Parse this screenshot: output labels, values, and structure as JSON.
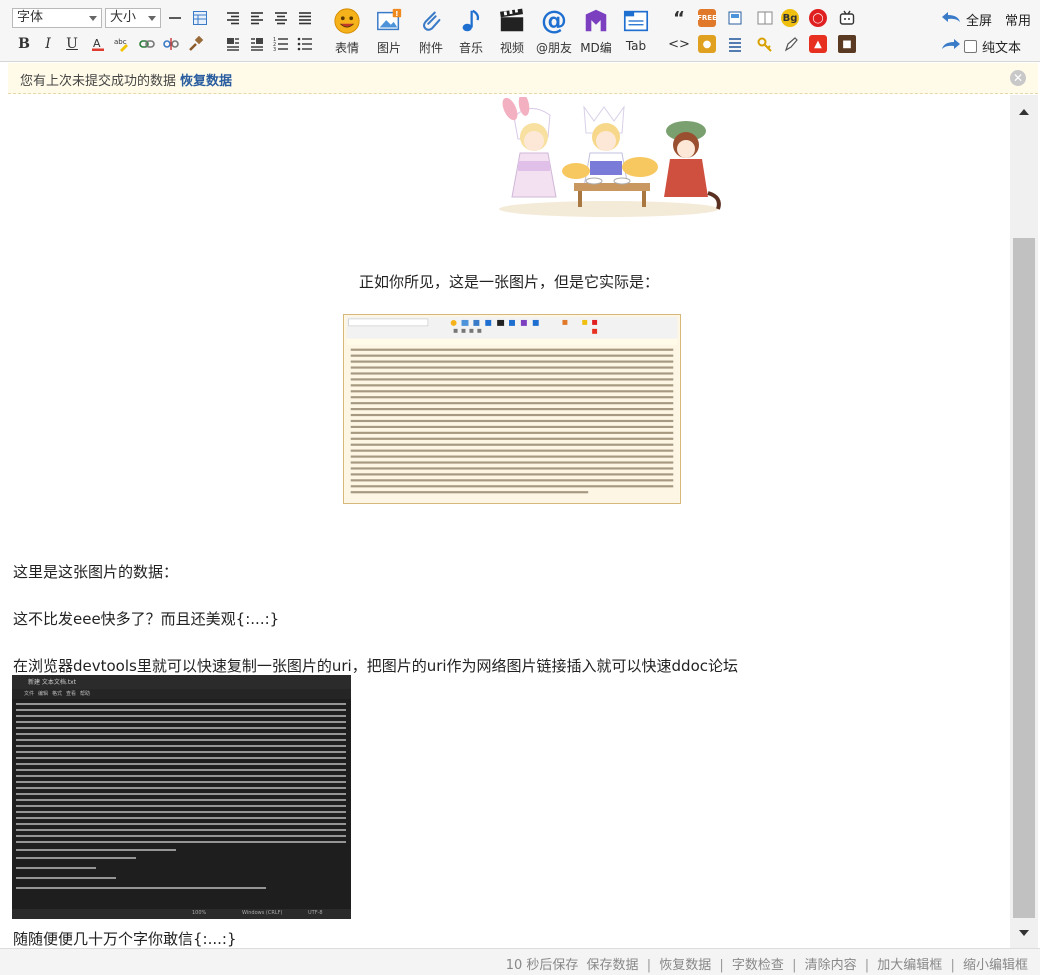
{
  "toolbar": {
    "font_select": "字体",
    "size_select": "大小",
    "big_buttons": [
      {
        "label": "表情"
      },
      {
        "label": "图片"
      },
      {
        "label": "附件"
      },
      {
        "label": "音乐"
      },
      {
        "label": "视频"
      },
      {
        "label": "@朋友"
      },
      {
        "label": "MD编"
      },
      {
        "label": "Tab"
      }
    ],
    "fullscreen_label": "全屏",
    "common_label": "常用",
    "plaintext_label": "纯文本",
    "bg_badge": "Bg"
  },
  "notice": {
    "message": "您有上次未提交成功的数据",
    "restore_link": "恢复数据"
  },
  "content": {
    "caption_1": "正如你所见，这是一张图片，但是它实际是：",
    "line_data": "这里是这张图片的数据：",
    "line_compare": "这不比发eee快多了？而且还美观{:...:}",
    "line_devtools": "在浏览器devtools里就可以快速复制一张图片的uri，把图片的uri作为网络图片链接插入就可以快速ddoc论坛",
    "line_last": "随随便便几十万个字你敢信{:...:}",
    "screenshot_window_title": "新建 文本文档.txt",
    "screenshot_menu": [
      "文件",
      "编辑",
      "格式",
      "查看",
      "帮助"
    ],
    "screenshot_status": [
      "100%",
      "Windows (CRLF)",
      "UTF-8"
    ]
  },
  "status_bar": {
    "autosave": "10 秒后保存",
    "save": "保存数据",
    "restore": "恢复数据",
    "wordcheck": "字数检查",
    "clear": "清除内容",
    "enlarge": "加大编辑框",
    "shrink": "缩小编辑框"
  },
  "colors": {
    "link": "#2a5d9f",
    "notice_bg": "#fffbe8",
    "scroll_thumb": "#c1c1c1"
  }
}
